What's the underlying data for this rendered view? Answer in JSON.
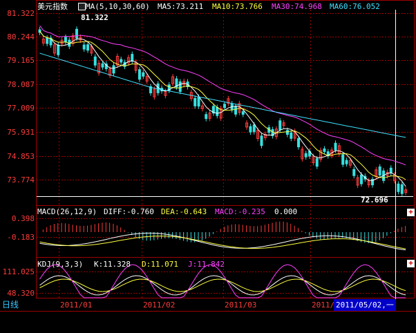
{
  "main": {
    "title": "美元指数",
    "ma_label": "MA(5,10,30,60)",
    "ma5": "MA5:73.211",
    "ma10": "MA10:73.766",
    "ma30": "MA30:74.968",
    "ma60": "MA60:76.052",
    "axis": [
      "81.322",
      "80.244",
      "79.165",
      "78.087",
      "77.009",
      "75.931",
      "74.853",
      "73.774"
    ],
    "high_label": "81.322",
    "low_label": "72.696"
  },
  "macd": {
    "label": "MACD(26,12,9)",
    "diff": "DIFF:-0.760",
    "dea": "DEA:-0.643",
    "macd": "MACD:-0.235",
    "extra": "0.000",
    "axis": [
      "0.398",
      "-0.183"
    ]
  },
  "kdj": {
    "label": "KDJ(9,3,3)",
    "k": "K:11.328",
    "d": "D:11.071",
    "j": "J:11.842",
    "axis": [
      "111.025",
      "48.320"
    ]
  },
  "footer": {
    "tab": "日线",
    "dates": [
      "2011/01",
      "2011/02",
      "2011/03",
      "2011/04"
    ],
    "cursor_date": "2011/05/02,一"
  },
  "buttons": {
    "plus": "+"
  },
  "colors": {
    "up": "#ff3b3b",
    "down": "#37e0e0",
    "ma5": "#ffffff",
    "ma10": "#ffff40",
    "ma30": "#ff40ff",
    "ma60": "#40e0ff",
    "grid": "#a00000"
  }
}
